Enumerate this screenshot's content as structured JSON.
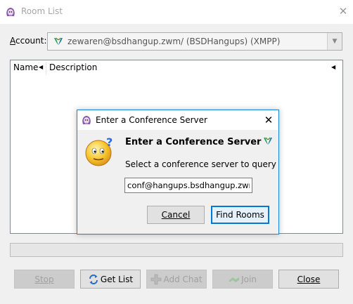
{
  "window": {
    "title": "Room List",
    "close_glyph": "✕"
  },
  "account": {
    "label_mnemonic": "A",
    "label_rest": "ccount:",
    "value": "zewaren@bsdhangup.zwm/ (BSDHangups) (XMPP)",
    "icon": "xmpp-icon",
    "dropdown_glyph": "▼"
  },
  "list": {
    "columns": [
      "Name",
      "Description"
    ],
    "sort_glyph": "◀",
    "rows": []
  },
  "progress": {
    "value": 0
  },
  "buttons": {
    "stop": "Stop",
    "get_list": "Get List",
    "add_chat": "Add Chat",
    "join": "Join",
    "close": "Close"
  },
  "dialog": {
    "title": "Enter a Conference Server",
    "close_glyph": "✕",
    "heading": "Enter a Conference Server",
    "subtext": "Select a conference server to query",
    "input_value": "conf@hangups.bsdhangup.zwm",
    "cancel": "Cancel",
    "find_rooms": "Find Rooms"
  },
  "colors": {
    "accent": "#0078d7",
    "dialog_border": "#1883d7",
    "window_bg": "#f0f0f0"
  }
}
